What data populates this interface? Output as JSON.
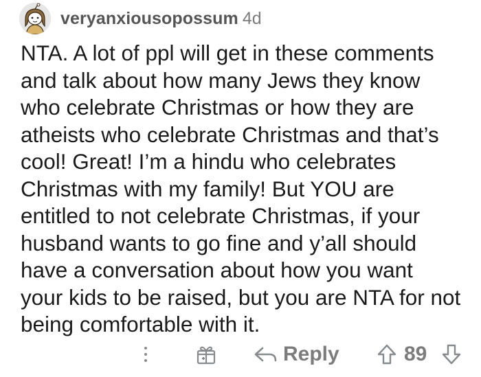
{
  "comment": {
    "author": "veryanxiousopossum",
    "age": "4d",
    "body": "NTA. A lot of ppl will get in these comments\nand talk about how many Jews they know\nwho celebrate Christmas or how they are\natheists who celebrate Christmas and that’s\ncool! Great! I’m a hindu who celebrates\nChristmas with my family! But YOU are\nentitled to not celebrate Christmas, if your\nhusband wants to go fine and y’all should\nhave a conversation about how you want\nyour kids to be raised, but you are NTA for not\nbeing comfortable with it.",
    "avatar_icon": "snoo-avatar-icon"
  },
  "actions": {
    "more_icon": "more-options-icon",
    "award_icon": "award-icon",
    "reply_icon": "reply-arrow-icon",
    "reply_label": "Reply",
    "upvote_icon": "upvote-arrow-icon",
    "score": "89",
    "downvote_icon": "downvote-arrow-icon"
  },
  "colors": {
    "text": "#1a1a1b",
    "meta": "#7c7c7c",
    "icon": "#878a8c",
    "background": "#ffffff"
  }
}
